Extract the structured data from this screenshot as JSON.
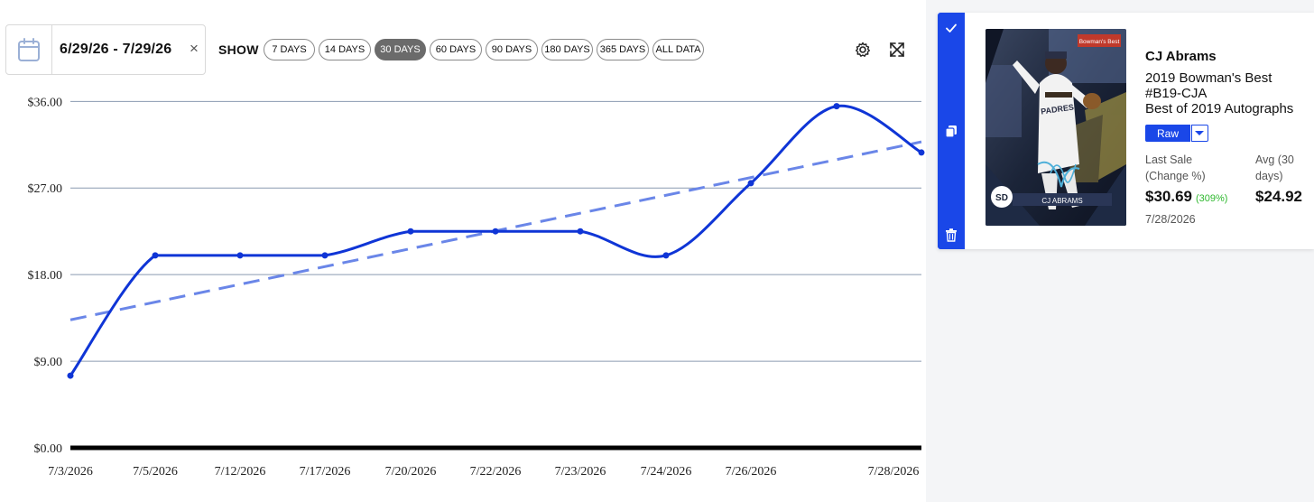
{
  "date_range": "6/29/26 - 7/29/26",
  "show_label": "SHOW",
  "ranges": [
    "7 DAYS",
    "14 DAYS",
    "30 DAYS",
    "60 DAYS",
    "90 DAYS",
    "180 DAYS",
    "365 DAYS",
    "ALL DATA"
  ],
  "active_range": "30 DAYS",
  "icons": {
    "calendar": "calendar-icon",
    "clear": "close-icon",
    "settings": "gear-icon",
    "expand": "expand-icon",
    "check": "check-icon",
    "copy": "copy-icon",
    "delete": "trash-icon",
    "dropdown": "chevron-down-icon"
  },
  "colors": {
    "series": "#0f35d6",
    "trend": "#6a86e8",
    "accent": "#1a47e8",
    "positive": "#2eb82e"
  },
  "chart_data": {
    "type": "line",
    "categories": [
      "7/3/2026",
      "7/5/2026",
      "7/12/2026",
      "7/17/2026",
      "7/20/2026",
      "7/22/2026",
      "7/23/2026",
      "7/24/2026",
      "7/26/2026",
      "",
      "7/28/2026"
    ],
    "x_tick_labels": [
      "7/3/2026",
      "7/5/2026",
      "7/12/2026",
      "7/17/2026",
      "7/20/2026",
      "7/22/2026",
      "7/23/2026",
      "7/24/2026",
      "7/26/2026",
      "7/28/2026"
    ],
    "y_tick_labels": [
      "$0.00",
      "$9.00",
      "$18.00",
      "$27.00",
      "$36.00"
    ],
    "yticks": [
      0,
      9,
      18,
      27,
      36
    ],
    "ylim": [
      0,
      36.5
    ],
    "series": [
      {
        "values": [
          7.5,
          20.0,
          20.0,
          20.0,
          22.5,
          22.5,
          22.5,
          20.0,
          27.5,
          35.5,
          30.69
        ]
      }
    ],
    "trendline": {
      "start": 13.3,
      "end": 31.8,
      "style": "dashed"
    },
    "grid": true,
    "legend": "none"
  },
  "card": {
    "player": "CJ Abrams",
    "set_lines": [
      "2019 Bowman's Best",
      "#B19-CJA",
      "Best of 2019 Autographs"
    ],
    "grade": "Raw",
    "last_sale_label": [
      "Last Sale",
      "(Change %)"
    ],
    "last_sale_value": "$30.69",
    "change_pct": "(309%)",
    "avg_label": [
      "Avg (30",
      "days)"
    ],
    "avg_value": "$24.92",
    "sale_date": "7/28/2026",
    "image_text": {
      "logo": "Bowman's Best",
      "team": "PADRES",
      "name_plate": "CJ ABRAMS",
      "team_logo": "SD"
    }
  }
}
